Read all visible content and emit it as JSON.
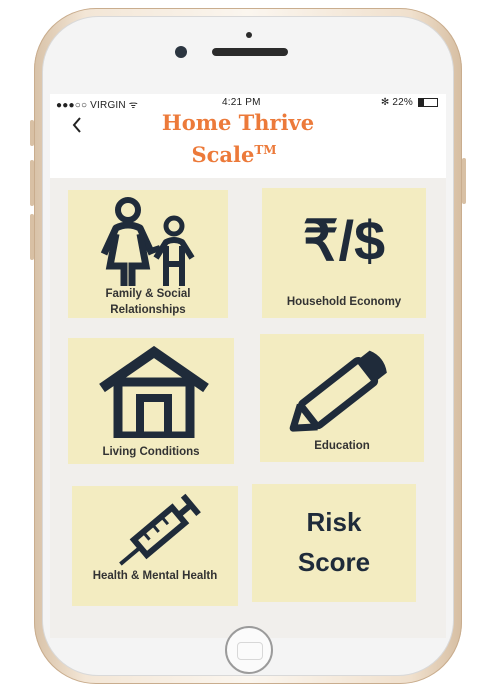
{
  "status_bar": {
    "carrier": "●●●○○ VIRGIN ᯤ",
    "time": "4:21 PM",
    "battery": "✻ 22%"
  },
  "header": {
    "back_icon": "chevron-left-icon",
    "title_line1": "Home Thrive",
    "title_line2": "Scale",
    "trademark": "TM"
  },
  "tiles": [
    {
      "label": "Family & Social Relationships",
      "icon": "family-icon"
    },
    {
      "label": "Household Economy",
      "icon": "currency-icon",
      "icon_text": "₹/$"
    },
    {
      "label": "Living Conditions",
      "icon": "house-icon"
    },
    {
      "label": "Education",
      "icon": "pencil-icon"
    },
    {
      "label": "Health & Mental Health",
      "icon": "syringe-icon"
    },
    {
      "label_line1": "Risk",
      "label_line2": "Score"
    }
  ],
  "colors": {
    "accent": "#ec7a3a",
    "tile_bg": "#f3ecc1",
    "icon": "#1f2b3a",
    "screen_bg": "#f1efec"
  }
}
